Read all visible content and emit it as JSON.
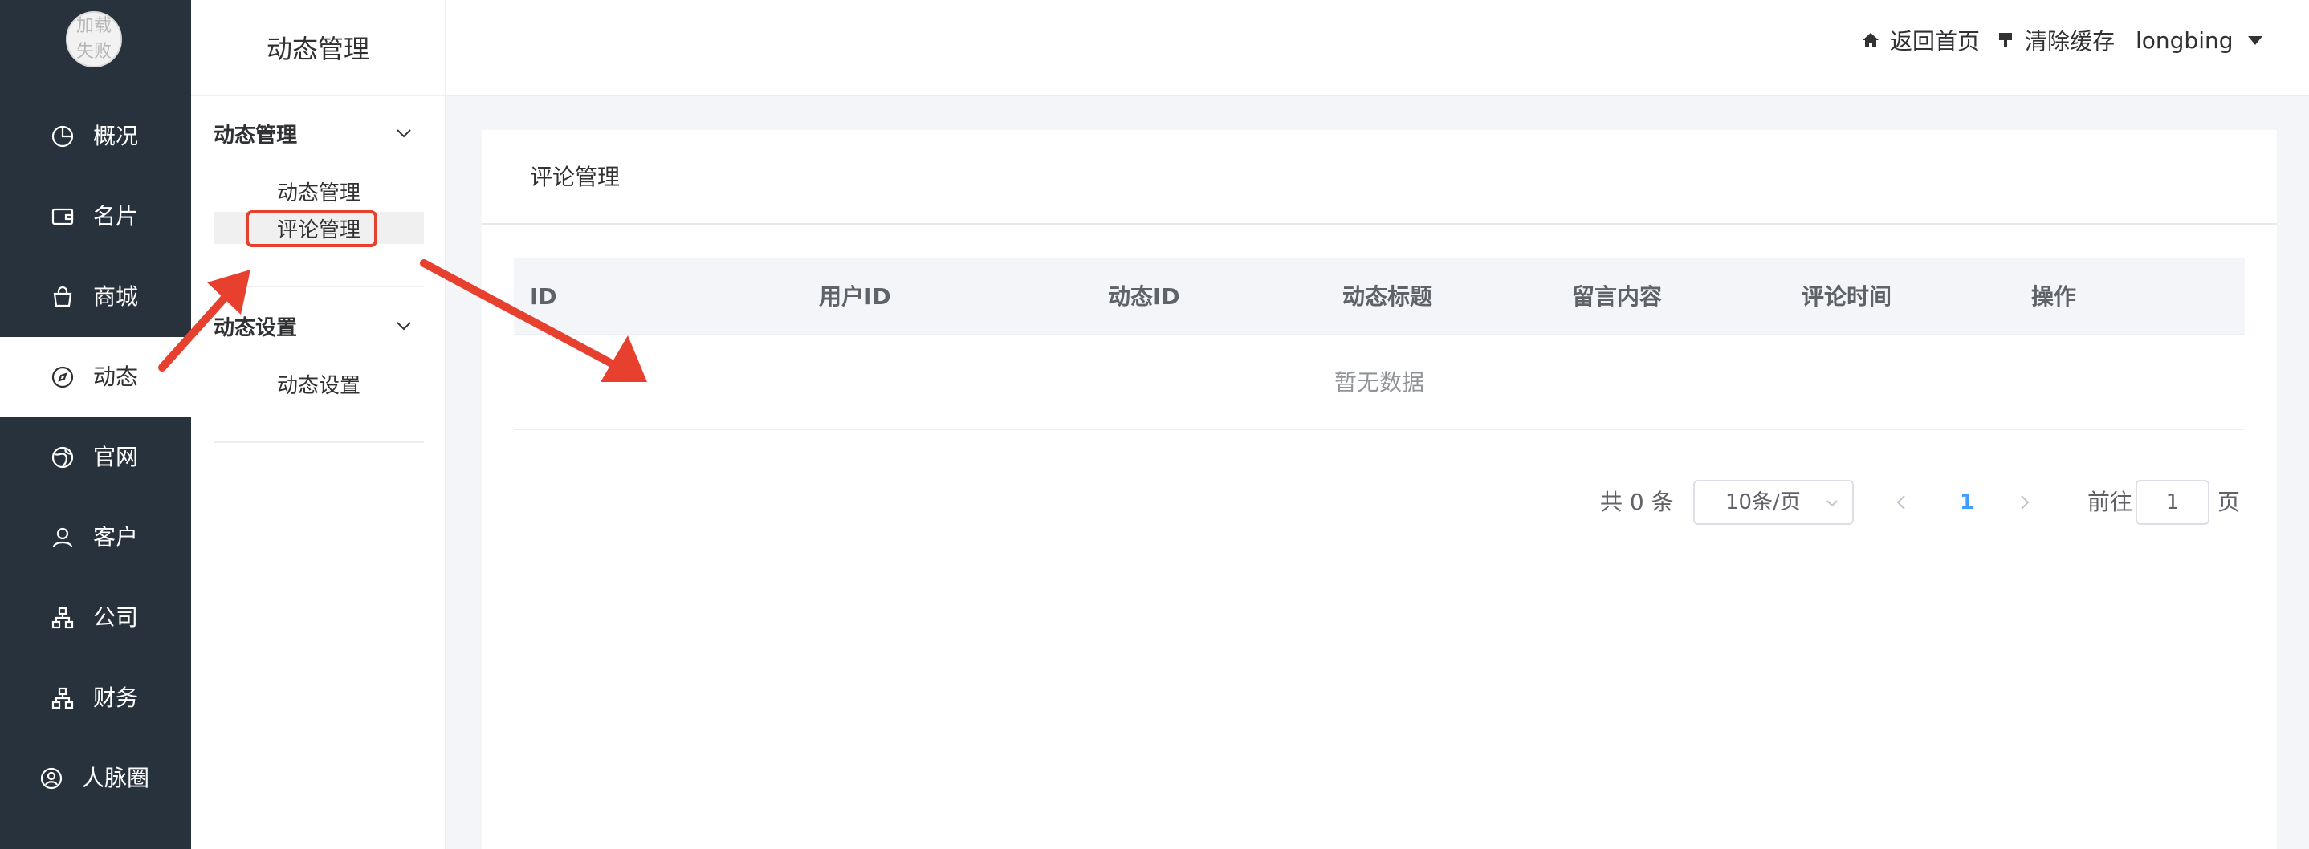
{
  "sidebar": {
    "avatar_text": "加载失败",
    "items": [
      {
        "label": "概况",
        "icon": "pie-chart-icon"
      },
      {
        "label": "名片",
        "icon": "wallet-icon"
      },
      {
        "label": "商城",
        "icon": "shopping-bag-icon"
      },
      {
        "label": "动态",
        "icon": "compass-icon",
        "active": true
      },
      {
        "label": "官网",
        "icon": "globe-icon"
      },
      {
        "label": "客户",
        "icon": "user-icon"
      },
      {
        "label": "公司",
        "icon": "org-chart-icon"
      },
      {
        "label": "财务",
        "icon": "org-chart-icon"
      },
      {
        "label": "人脉圈",
        "icon": "user-circle-icon"
      }
    ]
  },
  "subnav": {
    "title": "动态管理",
    "groups": [
      {
        "label": "动态管理",
        "items": [
          {
            "label": "动态管理"
          },
          {
            "label": "评论管理",
            "active": true
          }
        ]
      },
      {
        "label": "动态设置",
        "items": [
          {
            "label": "动态设置"
          }
        ]
      }
    ]
  },
  "header": {
    "home_label": "返回首页",
    "clear_cache_label": "清除缓存",
    "username": "longbing"
  },
  "main": {
    "card_title": "评论管理",
    "columns": [
      "ID",
      "用户ID",
      "动态ID",
      "动态标题",
      "留言内容",
      "评论时间",
      "操作"
    ],
    "empty_text": "暂无数据"
  },
  "pagination": {
    "total_text": "共 0 条",
    "page_size": "10条/页",
    "current_page": "1",
    "goto_label": "前往",
    "goto_value": "1",
    "page_suffix": "页"
  },
  "colors": {
    "sidebar_bg": "#28323d",
    "accent": "#409eff",
    "annotation_red": "#e8402f"
  }
}
